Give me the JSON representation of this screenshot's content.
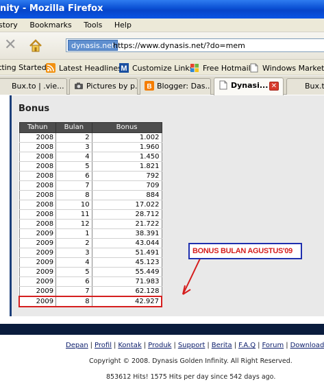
{
  "window": {
    "title": "nity - Mozilla Firefox"
  },
  "menu": {
    "items": [
      "story",
      "Bookmarks",
      "Tools",
      "Help"
    ]
  },
  "nav": {
    "site_badge": "dynasis.net",
    "url": "https://www.dynasis.net/?do=mem"
  },
  "bookmarks": {
    "items": [
      {
        "label": "tting Started",
        "icon": "page-icon"
      },
      {
        "label": "Latest Headlines",
        "icon": "rss-feed-icon"
      },
      {
        "label": "Customize Links",
        "icon": "msn-icon"
      },
      {
        "label": "Free Hotmail",
        "icon": "windows-flag-icon"
      },
      {
        "label": "Windows Marketpla",
        "icon": "page-icon"
      }
    ]
  },
  "tabs": [
    {
      "label": "Bux.to | .vie...",
      "active": false
    },
    {
      "label": "Pictures by p...",
      "active": false
    },
    {
      "label": "Blogger: Das...",
      "active": false
    },
    {
      "label": "Dynasi...",
      "active": true
    },
    {
      "label": "Bux.t",
      "active": false
    }
  ],
  "page": {
    "section_title": "Bonus",
    "table": {
      "headers": [
        "Tahun",
        "Bulan",
        "Bonus"
      ],
      "rows": [
        [
          "2008",
          "2",
          "1.002"
        ],
        [
          "2008",
          "3",
          "1.960"
        ],
        [
          "2008",
          "4",
          "1.450"
        ],
        [
          "2008",
          "5",
          "1.821"
        ],
        [
          "2008",
          "6",
          "792"
        ],
        [
          "2008",
          "7",
          "709"
        ],
        [
          "2008",
          "8",
          "884"
        ],
        [
          "2008",
          "10",
          "17.022"
        ],
        [
          "2008",
          "11",
          "28.712"
        ],
        [
          "2008",
          "12",
          "21.722"
        ],
        [
          "2009",
          "1",
          "38.391"
        ],
        [
          "2009",
          "2",
          "43.044"
        ],
        [
          "2009",
          "3",
          "51.491"
        ],
        [
          "2009",
          "4",
          "45.123"
        ],
        [
          "2009",
          "5",
          "55.449"
        ],
        [
          "2009",
          "6",
          "71.983"
        ],
        [
          "2009",
          "7",
          "62.128"
        ],
        [
          "2009",
          "8",
          "42.927"
        ]
      ],
      "highlighted_row": 17
    },
    "annotation": "BONUS BULAN AGUSTUS'09",
    "annotation_color": "#d51e1e",
    "annotation_border": "#1e2fae"
  },
  "footer": {
    "links": [
      "Depan",
      "Profil",
      "Kontak",
      "Produk",
      "Support",
      "Berita",
      "F.A.Q",
      "Forum",
      "Download"
    ],
    "copyright": "Copyright © 2008. Dynasis Golden Infinity. All Right Reserved.",
    "hits": "853612 Hits! 1575 Hits per day since 542 days ago."
  }
}
